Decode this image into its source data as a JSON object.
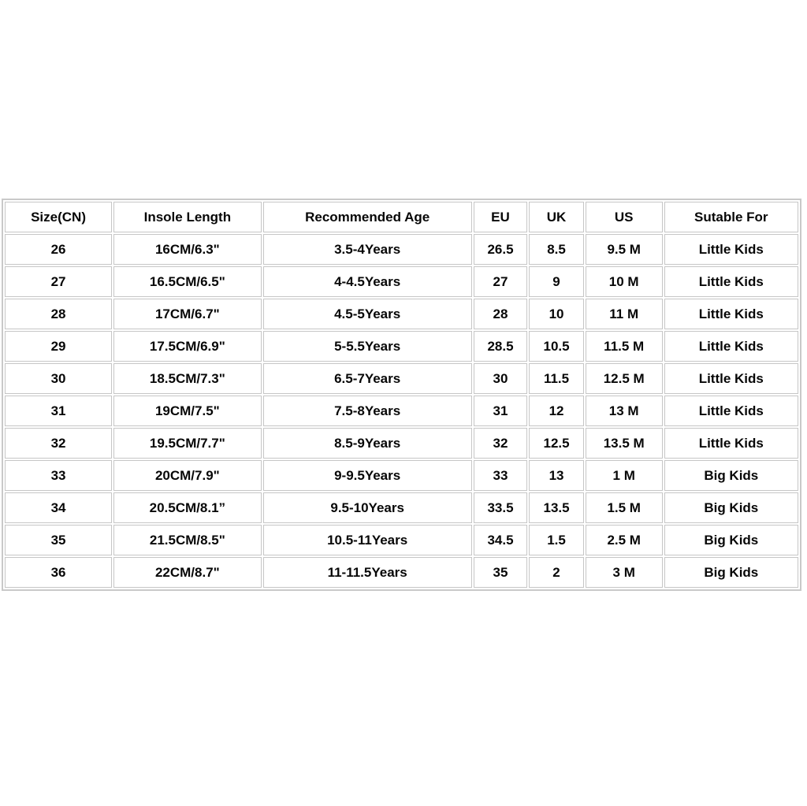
{
  "page": {
    "background_color": "#ffffff",
    "table_border_color": "#c9c9c9",
    "cell_border_color": "#c6c6c6",
    "text_color": "#070707"
  },
  "table": {
    "name": "shoe-size-chart",
    "columns": [
      "Size(CN)",
      "Insole Length",
      "Recommended Age",
      "EU",
      "UK",
      "US",
      "Sutable For"
    ],
    "rows": [
      [
        "26",
        "16CM/6.3\"",
        "3.5-4Years",
        "26.5",
        "8.5",
        "9.5 M",
        "Little Kids"
      ],
      [
        "27",
        "16.5CM/6.5\"",
        "4-4.5Years",
        "27",
        "9",
        "10 M",
        "Little Kids"
      ],
      [
        "28",
        "17CM/6.7\"",
        "4.5-5Years",
        "28",
        "10",
        "11 M",
        "Little Kids"
      ],
      [
        "29",
        "17.5CM/6.9\"",
        "5-5.5Years",
        "28.5",
        "10.5",
        "11.5 M",
        "Little Kids"
      ],
      [
        "30",
        "18.5CM/7.3\"",
        "6.5-7Years",
        "30",
        "11.5",
        "12.5 M",
        "Little Kids"
      ],
      [
        "31",
        "19CM/7.5\"",
        "7.5-8Years",
        "31",
        "12",
        "13 M",
        "Little Kids"
      ],
      [
        "32",
        "19.5CM/7.7\"",
        "8.5-9Years",
        "32",
        "12.5",
        "13.5 M",
        "Little Kids"
      ],
      [
        "33",
        "20CM/7.9\"",
        "9-9.5Years",
        "33",
        "13",
        "1 M",
        "Big Kids"
      ],
      [
        "34",
        "20.5CM/8.1”",
        "9.5-10Years",
        "33.5",
        "13.5",
        "1.5 M",
        "Big Kids"
      ],
      [
        "35",
        "21.5CM/8.5\"",
        "10.5-11Years",
        "34.5",
        "1.5",
        "2.5 M",
        "Big Kids"
      ],
      [
        "36",
        "22CM/8.7\"",
        "11-11.5Years",
        "35",
        "2",
        "3 M",
        "Big Kids"
      ]
    ]
  }
}
